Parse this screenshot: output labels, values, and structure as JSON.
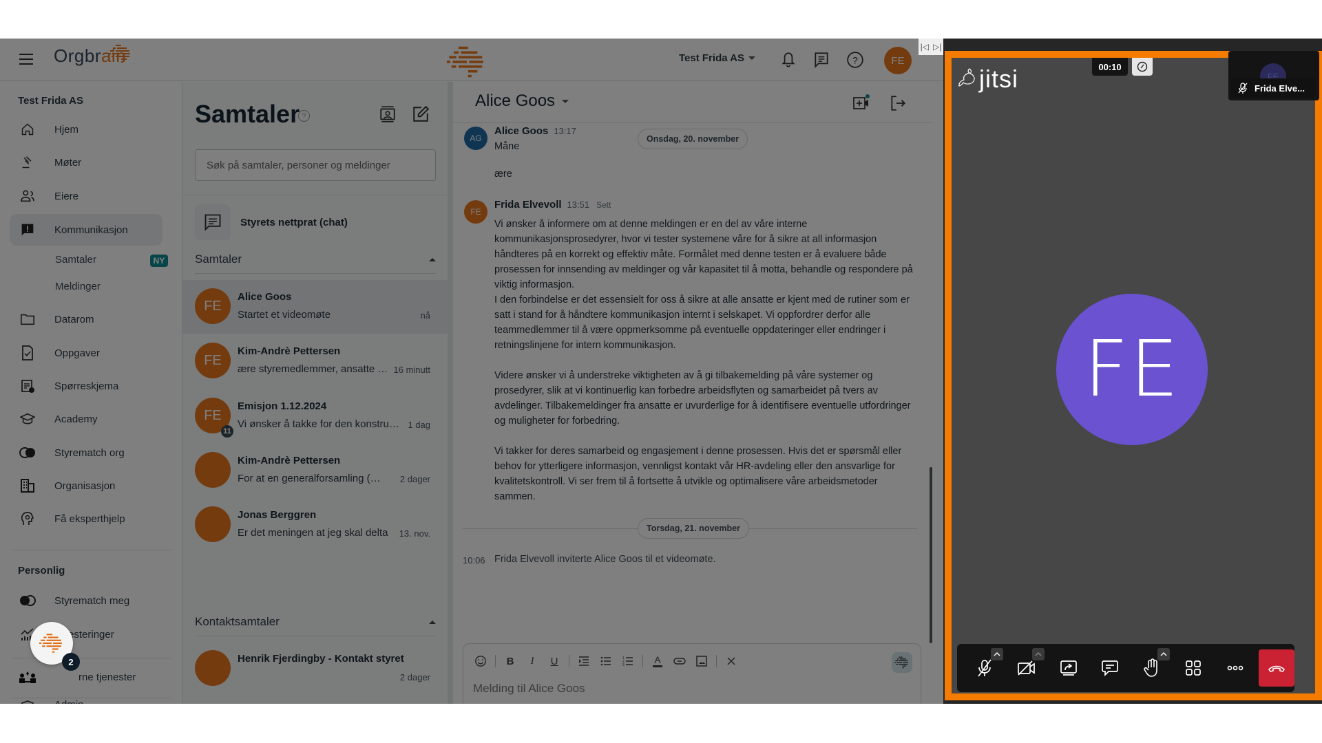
{
  "app": {
    "brand_prefix": "Orgbr",
    "brand_suffix": "ain",
    "org_selector": "Test Frida AS",
    "user_initials": "FE",
    "colors": {
      "brand_orange": "#e9771e",
      "teal_badge": "#0f8a96",
      "jitsi_border": "#f57c00",
      "jitsi_avatar": "#6a52d1",
      "hangup": "#cb2233"
    }
  },
  "sidebar": {
    "org_heading": "Test Frida AS",
    "items": [
      {
        "label": "Hjem",
        "icon": "home-icon"
      },
      {
        "label": "Møter",
        "icon": "gavel-icon"
      },
      {
        "label": "Eiere",
        "icon": "people-icon"
      },
      {
        "label": "Kommunikasjon",
        "icon": "chat-alert-icon",
        "active": true
      },
      {
        "label": "Datarom",
        "icon": "folder-icon"
      },
      {
        "label": "Oppgaver",
        "icon": "task-icon"
      },
      {
        "label": "Spørreskjema",
        "icon": "survey-icon"
      },
      {
        "label": "Academy",
        "icon": "graduation-cap-icon"
      },
      {
        "label": "Styrematch org",
        "icon": "styrematch-icon"
      },
      {
        "label": "Organisasjon",
        "icon": "building-icon"
      },
      {
        "label": "Få eksperthjelp",
        "icon": "expert-help-icon"
      }
    ],
    "sub_items": [
      {
        "label": "Samtaler",
        "badge": "NY"
      },
      {
        "label": "Meldinger"
      }
    ],
    "personal_heading": "Personlig",
    "personal_items": [
      {
        "label": "Styrematch meg",
        "icon": "styrematch-icon"
      },
      {
        "label": "Investeringer",
        "icon": "chart-icon"
      }
    ],
    "extra_items": [
      {
        "label": "Eksterne tjenester",
        "visible_label": "rne tjenester",
        "icon": "services-icon"
      },
      {
        "label": "Admin",
        "icon": "admin-icon"
      }
    ],
    "fab_badge": "2"
  },
  "chat_list": {
    "title": "Samtaler",
    "search_placeholder": "Søk på samtaler, personer og meldinger",
    "board_chat": "Styrets nettprat (chat)",
    "group_conversations": "Samtaler",
    "group_contacts": "Kontaktsamtaler",
    "conversations": [
      {
        "name": "Alice Goos",
        "preview": "Startet et videomøte",
        "time": "nå",
        "initials": "FE",
        "active": true
      },
      {
        "name": "Kim-Andrè Pettersen",
        "preview": "ære styremedlemmer, ansatte og aksjonærer",
        "time": "16 minutt",
        "initials": "FE"
      },
      {
        "name": "Emisjon 1.12.2024",
        "preview": "Vi ønsker å takke for den konstruktive",
        "time": "1 dag",
        "initials": "FE",
        "count": "11"
      },
      {
        "name": "Kim-Andrè Pettersen",
        "preview": "For at en generalforsamling (GF) skal",
        "time": "2 dager",
        "photo": true
      },
      {
        "name": "Jonas Berggren",
        "preview": "Er det meningen at jeg skal delta",
        "time": "13. nov.",
        "photo": true
      }
    ],
    "contact_conversations": [
      {
        "name": "Henrik Fjerdingby - Kontakt styret",
        "preview": "",
        "time": "2 dager",
        "photo": true
      }
    ]
  },
  "chat": {
    "title": "Alice Goos",
    "messages": [
      {
        "sender": "Alice Goos",
        "initials": "AG",
        "time": "13:17",
        "lines": [
          "Måne",
          "",
          "ære"
        ]
      },
      {
        "sender": "Frida Elvevoll",
        "initials": "FE",
        "time": "13:51",
        "status": "Sett",
        "paragraphs": [
          "Vi ønsker å informere om at denne meldingen er en del av våre interne kommunikasjonsprosedyrer, hvor vi tester systemene våre for å sikre at all informasjon håndteres på en korrekt og effektiv måte. Formålet med denne testen er å evaluere både prosessen for innsending av meldinger og vår kapasitet til å motta, behandle og respondere på viktig informasjon.",
          "I den forbindelse er det essensielt for oss å sikre at alle ansatte er kjent med de rutiner som er satt i stand for å håndtere kommunikasjon internt i selskapet. Vi oppfordrer derfor alle teammedlemmer til å være oppmerksomme på eventuelle oppdateringer eller endringer i retningslinjene for intern kommunikasjon.",
          "Videre ønsker vi å understreke viktigheten av å gi tilbakemelding på våre systemer og prosedyrer, slik at vi kontinuerlig kan forbedre arbeidsflyten og samarbeidet på tvers av avdelinger. Tilbakemeldinger fra ansatte er uvurderlige for å identifisere eventuelle utfordringer og muligheter for forbedring.",
          "Vi takker for deres samarbeid og engasjement i denne prosessen. Hvis det er spørsmål eller behov for ytterligere informasjon, vennligst kontakt vår HR-avdeling eller den ansvarlige for kvalitetskontroll. Vi ser frem til å fortsette å utvikle og optimalisere våre arbeidsmetoder sammen."
        ]
      }
    ],
    "date_separators": [
      "Onsdag, 20. november",
      "Torsdag, 21. november"
    ],
    "system_event": {
      "time": "10:06",
      "text": "Frida Elvevoll inviterte Alice Goos til et videomøte."
    },
    "composer_placeholder": "Melding til Alice Goos"
  },
  "jitsi": {
    "logo": "jitsi",
    "timer": "00:10",
    "participant_thumb_name": "Frida Elve...",
    "participant_thumb_initials": "FE",
    "main_avatar_initials": "FE",
    "toolbar": [
      "microphone-muted",
      "camera-off",
      "share-screen",
      "chat",
      "raise-hand",
      "tile-view",
      "more-options",
      "hang-up"
    ]
  }
}
